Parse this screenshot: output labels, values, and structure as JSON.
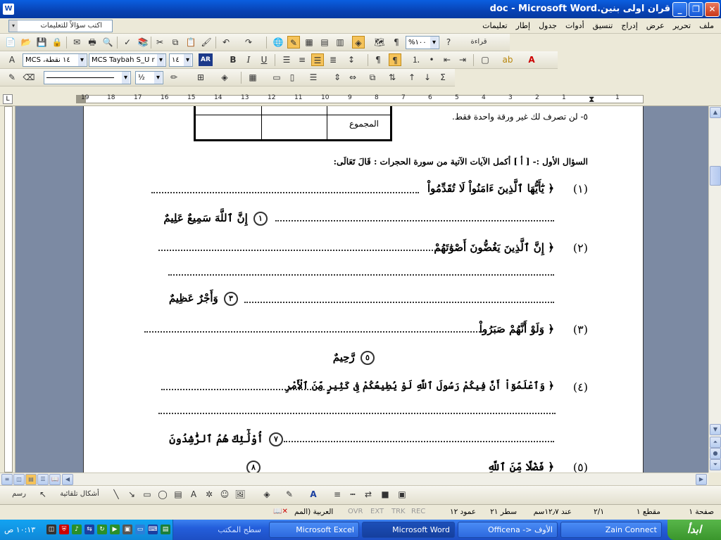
{
  "window": {
    "title": "قران اولى بنين.doc - Microsoft Word",
    "app_icon": "W"
  },
  "menubar": {
    "items": [
      "ملف",
      "تحرير",
      "عرض",
      "إدراج",
      "تنسيق",
      "أدوات",
      "جدول",
      "إطار",
      "تعليمات"
    ],
    "ask_placeholder": "اكتب سؤالاً للتعليمات"
  },
  "toolbar_standard": {
    "zoom": "%١٠٠",
    "read_label": "قراءة"
  },
  "toolbar_format": {
    "style": "MCS ،١٤ نقطة",
    "font": "MCS Taybah S_U r",
    "size": "١٤",
    "rtl_badge": "AR"
  },
  "ruler": {
    "numbers": [
      "19",
      "18",
      "17",
      "16",
      "15",
      "14",
      "13",
      "12",
      "11",
      "10",
      "9",
      "8",
      "7",
      "6",
      "5",
      "4",
      "3",
      "2",
      "1",
      " ",
      "1"
    ]
  },
  "document": {
    "note_line": "٥- لن تصرف لك غير ورقة واحدة فقط.",
    "table_total": "المجموع",
    "question_header": "السؤال الأول :-  [ أ ]    أكمل الآيات الآتية من سورة الحجرات   :   قَالَ تَعَالَى:",
    "items": [
      {
        "num": "(١)",
        "verse": "﴿ يَٰٓأَيُّهَا ٱلَّذِينَ ءَامَنُواْ لَا تُقَدِّمُواْ"
      },
      {
        "num": "",
        "verse": "إِنَّ ٱللَّهَ سَمِيعٌ عَلِيمٌ",
        "ayah": "١"
      },
      {
        "num": "(٢)",
        "verse": "﴿ إِنَّ ٱلَّذِينَ يَغُضُّونَ أَصْوَٰتَهُمْ"
      },
      {
        "num": "",
        "verse": "وَأَجْرٌ عَظِيمٌ",
        "ayah": "٣"
      },
      {
        "num": "(٣)",
        "verse": "﴿ وَلَوْ أَنَّهُمْ صَبَرُواْ"
      },
      {
        "num": "",
        "verse": "رَّحِيمٌ",
        "ayah": "٥"
      },
      {
        "num": "(٤)",
        "verse": "﴿ وَٱعْلَمُوٓاْ أَنَّ فِيكُمْ رَسُولَ ٱللَّهِ لَوْ يُطِيعُكُمْ فِى كَثِيرٍ مِّنَ ٱلْأَمْرِ"
      },
      {
        "num": "",
        "verse": "أُوْلَٰٓئِكَ هُمُ ٱلرَّٰشِدُونَ",
        "ayah": "٧"
      },
      {
        "num": "(٥)",
        "verse": "﴿ فَضْلًا مِّنَ ٱللَّهِ",
        "ayah": "٨"
      }
    ]
  },
  "drawing": {
    "draw_label": "رسم",
    "autoshapes_label": "أشكال تلقائية"
  },
  "status": {
    "page": "صفحة ١",
    "section": "مقطع ١",
    "pages": "٢/١",
    "at": "عند ١٢٫٧سم",
    "line": "سطر ٢١",
    "column": "عمود ١٢",
    "rec": "REC",
    "trk": "TRK",
    "ext": "EXT",
    "ovr": "OVR",
    "language": "العربية (المم"
  },
  "taskbar": {
    "start": "ابدأ",
    "tasks": [
      "Zain Connect",
      "الأوف <- Officena",
      "Microsoft Word",
      "Microsoft Excel",
      "سطح المكتب"
    ],
    "clock": "١٠:١٣ ص"
  }
}
